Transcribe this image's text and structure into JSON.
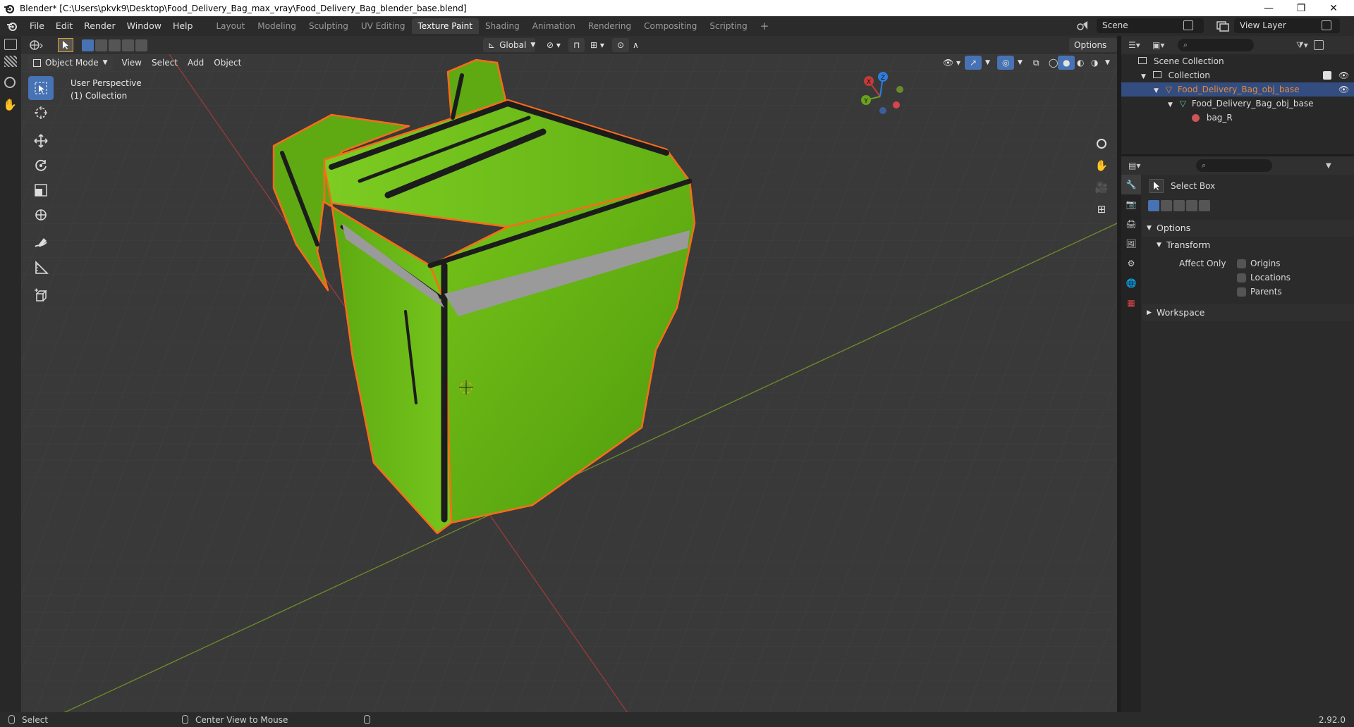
{
  "window": {
    "title": "Blender* [C:\\Users\\pkvk9\\Desktop\\Food_Delivery_Bag_max_vray\\Food_Delivery_Bag_blender_base.blend]",
    "minimize": "—",
    "maximize": "❐",
    "close": "✕"
  },
  "menu": {
    "items": [
      "File",
      "Edit",
      "Render",
      "Window",
      "Help"
    ]
  },
  "workspaces": {
    "tabs": [
      "Layout",
      "Modeling",
      "Sculpting",
      "UV Editing",
      "Texture Paint",
      "Shading",
      "Animation",
      "Rendering",
      "Compositing",
      "Scripting"
    ],
    "active": "Texture Paint",
    "add": "+"
  },
  "scene": {
    "label": "Scene",
    "view_layer": "View Layer"
  },
  "viewport_header": {
    "mode": "Object Mode",
    "menus": [
      "View",
      "Select",
      "Add",
      "Object"
    ],
    "orientation": "Global",
    "options": "Options"
  },
  "viewport": {
    "perspective": "User Perspective",
    "collection": "(1) Collection",
    "bag_color": "#6fbf14",
    "outline_color": "#ff6a1a"
  },
  "gizmo": {
    "x": "X",
    "y": "Y",
    "z": "Z"
  },
  "outliner": {
    "rows": [
      {
        "label": "Scene Collection",
        "indent": 0
      },
      {
        "label": "Collection",
        "indent": 1
      },
      {
        "label": "Food_Delivery_Bag_obj_base",
        "indent": 2,
        "selected": true
      },
      {
        "label": "Food_Delivery_Bag_obj_base",
        "indent": 3
      },
      {
        "label": "bag_R",
        "indent": 4
      }
    ]
  },
  "properties": {
    "tool_name": "Select Box",
    "options_label": "Options",
    "transform_label": "Transform",
    "affect_only": "Affect Only",
    "checks": [
      "Origins",
      "Locations",
      "Parents"
    ],
    "workspace_label": "Workspace"
  },
  "status": {
    "select": "Select",
    "center_view": "Center View to Mouse",
    "version": "2.92.0"
  }
}
